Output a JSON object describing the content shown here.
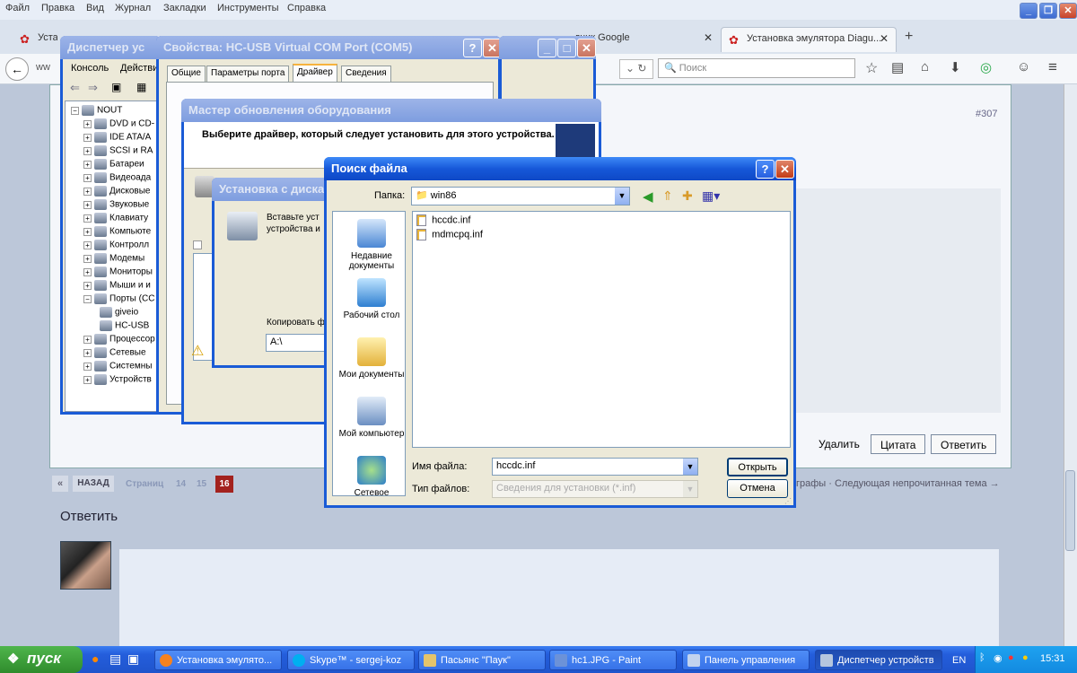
{
  "firefox": {
    "menu": [
      "Файл",
      "Правка",
      "Вид",
      "Журнал",
      "Закладки",
      "Инструменты",
      "Справка"
    ],
    "tabs": [
      {
        "label": "Устан"
      },
      {
        "label": "дчик Google"
      },
      {
        "label": "Установка эмулятора Diagu..."
      }
    ],
    "search_placeholder": "Поиск",
    "url_partial": "ww"
  },
  "page": {
    "post_number": "#307",
    "post_buttons": [
      "Удалить",
      "Цитата",
      "Ответить"
    ],
    "pager": {
      "back": "«",
      "back_label": "НАЗАД",
      "pages_label": "Страниц",
      "pages": [
        "14",
        "15",
        "16"
      ]
    },
    "right_link": "графы · Следующая непрочитанная тема →",
    "reply_heading": "Ответить"
  },
  "device_manager": {
    "title": "Диспетчер ус",
    "menu": [
      "Консоль",
      "Действи"
    ],
    "tree": [
      {
        "label": "NOUT",
        "exp": "−"
      },
      {
        "label": "DVD и CD-",
        "exp": "+"
      },
      {
        "label": "IDE ATA/A",
        "exp": "+"
      },
      {
        "label": "SCSI и RA",
        "exp": "+"
      },
      {
        "label": "Батареи",
        "exp": "+"
      },
      {
        "label": "Видеоада",
        "exp": "+"
      },
      {
        "label": "Дисковые",
        "exp": "+"
      },
      {
        "label": "Звуковые",
        "exp": "+"
      },
      {
        "label": "Клавиату",
        "exp": "+"
      },
      {
        "label": "Компьюте",
        "exp": "+"
      },
      {
        "label": "Контролл",
        "exp": "+"
      },
      {
        "label": "Модемы",
        "exp": "+"
      },
      {
        "label": "Мониторы",
        "exp": "+"
      },
      {
        "label": "Мыши и и",
        "exp": "+"
      },
      {
        "label": "Порты (CC",
        "exp": "−"
      },
      {
        "label": "giveio",
        "exp": ""
      },
      {
        "label": "HC-USB",
        "exp": ""
      },
      {
        "label": "Процессор",
        "exp": "+"
      },
      {
        "label": "Сетевые",
        "exp": "+"
      },
      {
        "label": "Системны",
        "exp": "+"
      },
      {
        "label": "Устройств",
        "exp": "+"
      }
    ]
  },
  "properties": {
    "title": "Свойства: HC-USB Virtual COM Port (COM5)",
    "tabs": [
      "Общие",
      "Параметры порта",
      "Драйвер",
      "Сведения"
    ]
  },
  "wizard": {
    "title": "Мастер обновления оборудования",
    "heading": "Выберите драйвер, который следует установить для этого устройства."
  },
  "install_disk": {
    "title": "Установка с диска",
    "text": "Вставьте уст\nустройства и",
    "copy_label": "Копировать ф",
    "path_value": "A:\\"
  },
  "file_dialog": {
    "title": "Поиск файла",
    "folder_label": "Папка:",
    "folder_value": "win86",
    "places": [
      "Недавние документы",
      "Рабочий стол",
      "Мои документы",
      "Мой компьютер",
      "Сетевое"
    ],
    "files": [
      "hccdc.inf",
      "mdmcpq.inf"
    ],
    "filename_label": "Имя файла:",
    "filename_value": "hccdc.inf",
    "filetype_label": "Тип файлов:",
    "filetype_value": "Сведения для установки (*.inf)",
    "open_button": "Открыть",
    "cancel_button": "Отмена"
  },
  "taskbar": {
    "start": "пуск",
    "tasks": [
      "Установка эмулято...",
      "Skype™ - sergej-koz",
      "Пасьянс \"Паук\"",
      "hc1.JPG - Paint",
      "Панель управления",
      "Диспетчер устройств"
    ],
    "lang": "EN",
    "clock": "15:31"
  }
}
